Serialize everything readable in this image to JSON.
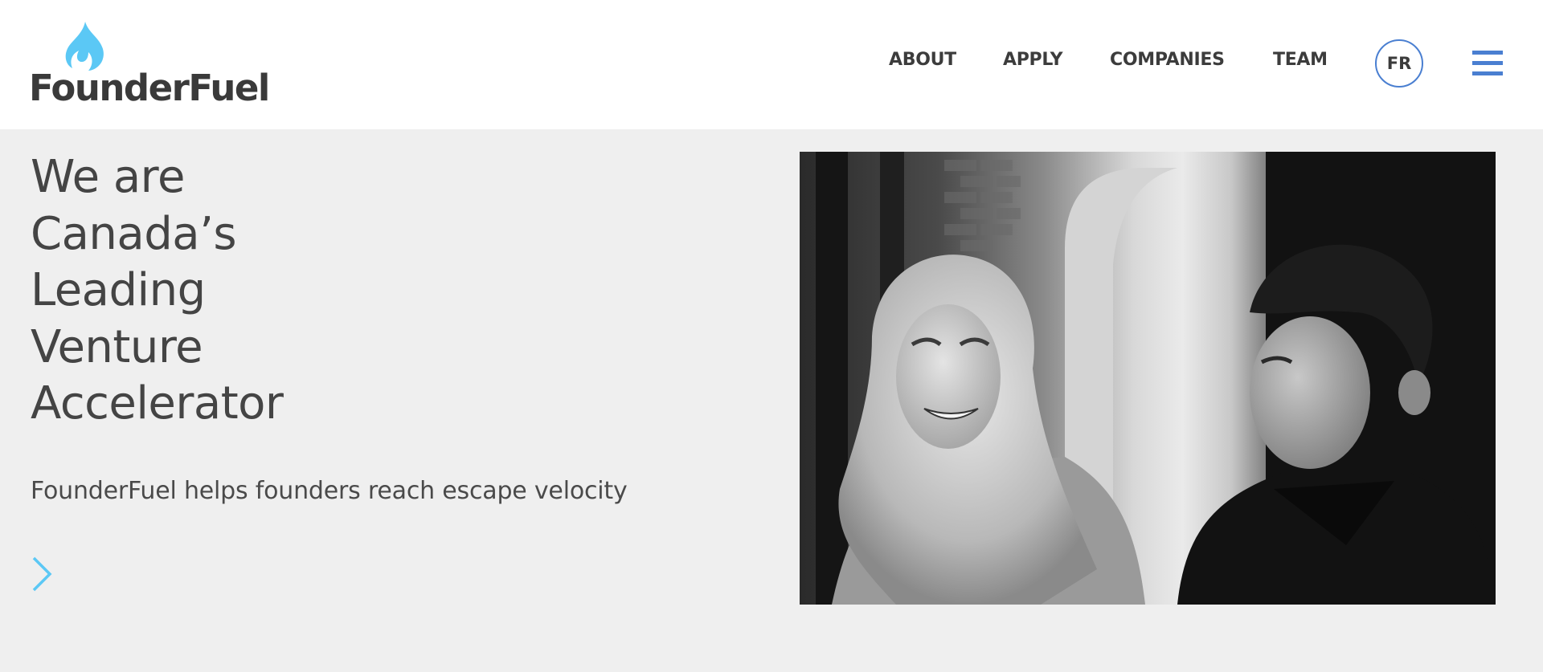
{
  "header": {
    "logo_text": "FounderFuel",
    "logo_icon": "flame-icon",
    "nav": [
      {
        "label": "ABOUT"
      },
      {
        "label": "APPLY"
      },
      {
        "label": "COMPANIES"
      },
      {
        "label": "TEAM"
      }
    ],
    "lang_label": "FR",
    "menu_icon": "hamburger-menu-icon"
  },
  "hero": {
    "headline_lines": [
      "We are",
      "Canada’s",
      "Leading",
      "Venture",
      "Accelerator"
    ],
    "tagline": "FounderFuel helps founders reach escape velocity",
    "next_icon": "chevron-right-icon",
    "photo_icon": "photo-of-founders"
  },
  "colors": {
    "background": "#efefef",
    "header_bg": "#ffffff",
    "accent_blue": "#4a7fd1",
    "flame_cyan": "#5bc8f5",
    "text_dark": "#444444"
  }
}
